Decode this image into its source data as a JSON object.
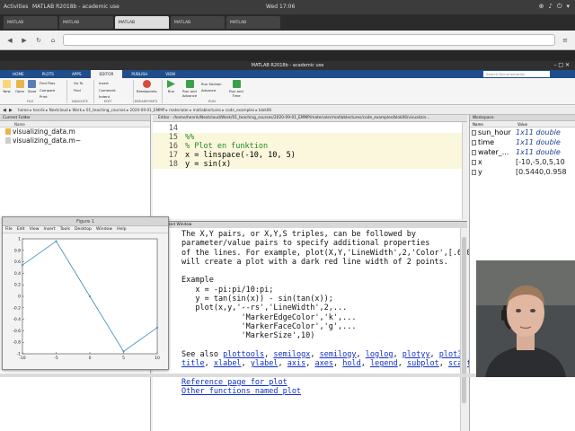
{
  "os": {
    "activities": "Activities",
    "app_name": "MATLAB R2018b - academic use",
    "clock": "Wed 17:06"
  },
  "browser": {
    "tabs": [
      "MATLAB",
      "MATLAB",
      "MATLAB",
      "MATLAB",
      "MATLAB"
    ],
    "url": ""
  },
  "matlab": {
    "window_top_title": "",
    "window_title": "MATLAB R2018b - academic use",
    "ribbon_tabs": [
      "HOME",
      "PLOTS",
      "APPS",
      "EDITOR",
      "PUBLISH",
      "VIEW"
    ],
    "active_tab": "EDITOR",
    "search_placeholder": "Search Documentation",
    "ribbon": {
      "new": "New",
      "open": "Open",
      "save": "Save",
      "find_files": "Find Files",
      "compare": "Compare",
      "print": "Print",
      "insert": "Insert",
      "comment": "Comment",
      "indent": "Indent",
      "go_to": "Go To",
      "find": "Find",
      "breakpoints": "Breakpoints",
      "run": "Run",
      "run_advance": "Run and Advance",
      "run_section": "Run Section",
      "advance": "Advance",
      "run_time": "Run and Time",
      "sec_file": "FILE",
      "sec_navigate": "NAVIGATE",
      "sec_edit": "EDIT",
      "sec_breakpoints": "BREAKPOINTS",
      "sec_run": "RUN"
    },
    "path": "home ▸ henrik ▸ Nextcloud ▸ Work ▸ 01_teaching_courses ▸ 2020-09-01_EMMP ▸ materialer ▸ matlablectures ▸ code_examples ▸ blok06",
    "current_folder": {
      "title": "Current Folder",
      "col_name": "Name",
      "files": [
        "visualizing_data.m",
        "visualizing_data.m~"
      ]
    },
    "editor": {
      "header": "Editor - /home/henrik/Nextcloud/Work/01_teaching_courses/2020-09-01_EMMP/materialer/matlablectures/code_examples/blok06/visualizin...",
      "lines": [
        {
          "n": "14",
          "text": ""
        },
        {
          "n": "15",
          "text": "%%"
        },
        {
          "n": "16",
          "text": "% Plot en funktion"
        },
        {
          "n": "17",
          "text": "x = linspace(-10, 10, 5)"
        },
        {
          "n": "18",
          "text": "y = sin(x)"
        }
      ]
    },
    "command_window": {
      "title": "Command Window",
      "lines": [
        "The X,Y pairs, or X,Y,S triples, can be followed by",
        "parameter/value pairs to specify additional properties",
        "of the lines. For example, plot(X,Y,'LineWidth',2,'Color',[.6 0 0])",
        "will create a plot with a dark red line width of 2 points.",
        "",
        "Example",
        "   x = -pi:pi/10:pi;",
        "   y = tan(sin(x)) - sin(tan(x));",
        "   plot(x,y,'--rs','LineWidth',2,...",
        "             'MarkerEdgeColor','k',...",
        "             'MarkerFaceColor','g',...",
        "             'MarkerSize',10)",
        ""
      ],
      "see_also_prefix": "See also ",
      "see_also_1": [
        "plottools",
        "semilogx",
        "semilogy",
        "loglog",
        "plotyy",
        "plot3",
        "grid"
      ],
      "see_also_2": [
        "title",
        "xlabel",
        "ylabel",
        "axis",
        "axes",
        "hold",
        "legend",
        "subplot",
        "scatter"
      ],
      "reference_link": "Reference page for plot",
      "other_link": "Other functions named plot"
    },
    "workspace": {
      "title": "Workspace",
      "col_name": "Name",
      "col_value": "Value",
      "vars": [
        {
          "name": "sun_hour",
          "value": "1x11 double",
          "italic": true
        },
        {
          "name": "time",
          "value": "1x11 double",
          "italic": true
        },
        {
          "name": "water_...",
          "value": "1x11 double",
          "italic": true
        },
        {
          "name": "x",
          "value": "[-10,-5,0,5,10",
          "italic": false
        },
        {
          "name": "y",
          "value": "[0.5440,0.958",
          "italic": false
        }
      ]
    },
    "figure": {
      "title": "Figure 1",
      "menu": [
        "File",
        "Edit",
        "View",
        "Insert",
        "Tools",
        "Desktop",
        "Window",
        "Help"
      ],
      "ytick_labels": [
        "1",
        "0.8",
        "0.6",
        "0.4",
        "0.2",
        "0",
        "-0.2",
        "-0.4",
        "-0.6",
        "-0.8",
        "-1"
      ],
      "xtick_labels": [
        "-10",
        "-5",
        "0",
        "5",
        "10"
      ],
      "line_color": "#4a90c8"
    }
  },
  "chart_data": {
    "type": "line",
    "x": [
      -10,
      -5,
      0,
      5,
      10
    ],
    "series": [
      {
        "values": [
          0.544,
          0.9589,
          0,
          -0.9589,
          -0.544
        ]
      }
    ],
    "xlim": [
      -10,
      10
    ],
    "ylim": [
      -1,
      1
    ],
    "grid": false
  }
}
